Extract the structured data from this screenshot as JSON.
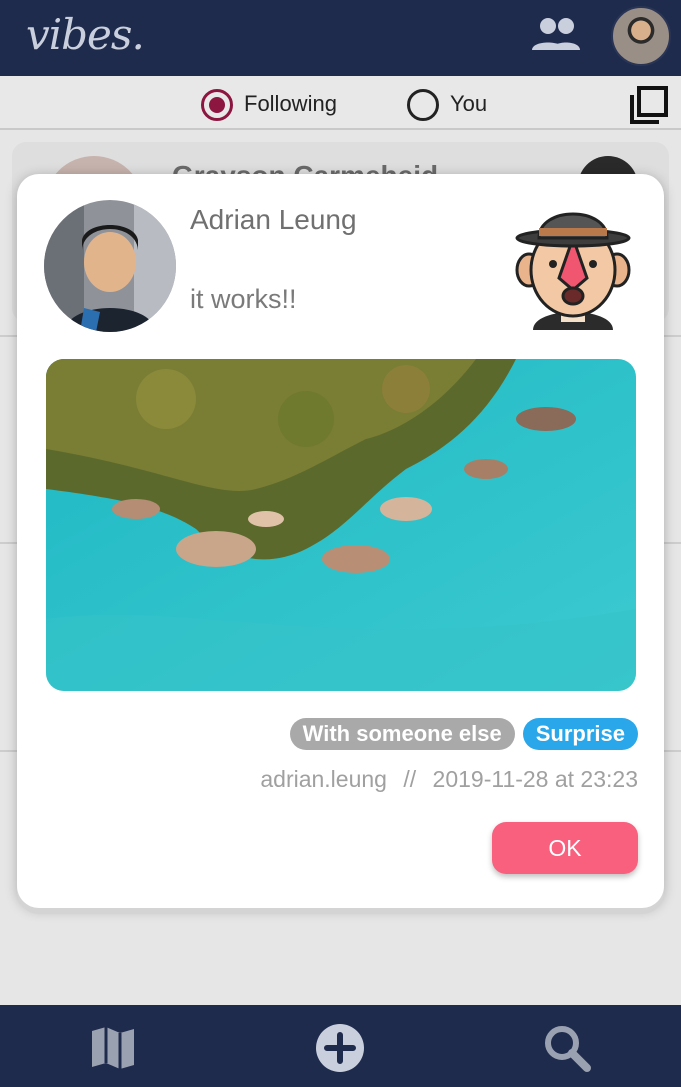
{
  "app": {
    "logo": "vibes."
  },
  "filter": {
    "options": [
      {
        "label": "Following",
        "selected": true
      },
      {
        "label": "You",
        "selected": false
      }
    ]
  },
  "background_feed": {
    "visible_name": "Grayson Carmeheid"
  },
  "modal": {
    "author_name": "Adrian Leung",
    "post_text": "it works!!",
    "tags": [
      {
        "label": "With someone else",
        "color": "#a9a9a9"
      },
      {
        "label": "Surprise",
        "color": "#2aa7ea"
      }
    ],
    "username": "adrian.leung",
    "separator": "//",
    "timestamp": "2019-11-28 at 23:23",
    "ok_label": "OK"
  },
  "icons": {
    "top": [
      "friends-icon",
      "profile-avatar"
    ],
    "filter": [
      "copy-icon"
    ],
    "bottom": [
      "map-icon",
      "add-icon",
      "search-icon"
    ]
  },
  "colors": {
    "bar": "#1f2b4d",
    "accent_pink": "#f8607e",
    "radio_selected": "#8c1640",
    "tag_blue": "#2aa7ea"
  }
}
